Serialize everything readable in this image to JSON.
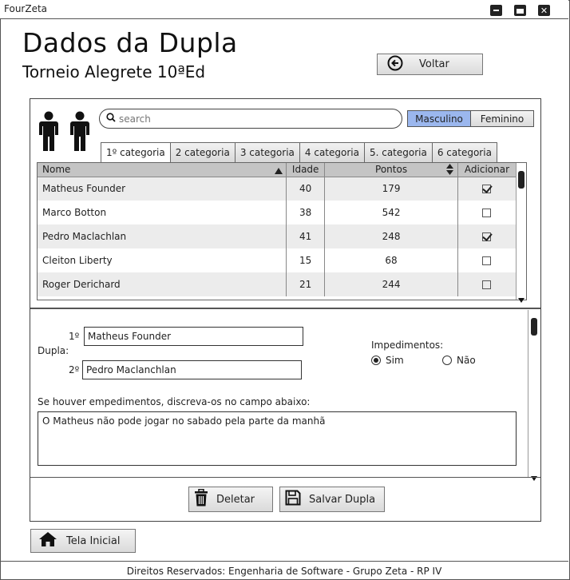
{
  "window": {
    "title": "FourZeta"
  },
  "header": {
    "title": "Dados da Dupla",
    "subtitle": "Torneio Alegrete 10ªEd",
    "back_label": "Voltar"
  },
  "search": {
    "placeholder": "search"
  },
  "gender": {
    "options": [
      "Masculino",
      "Feminino"
    ],
    "selected": "Masculino"
  },
  "tabs": [
    "1º categoria",
    "2 categoria",
    "3 categoria",
    "4 categoria",
    "5. categoria",
    "6 categoria"
  ],
  "active_tab": "1º categoria",
  "table": {
    "columns": [
      "Nome",
      "Idade",
      "Pontos",
      "Adicionar"
    ],
    "rows": [
      {
        "nome": "Matheus Founder",
        "idade": "40",
        "pontos": "179",
        "adicionar": true
      },
      {
        "nome": "Marco Botton",
        "idade": "38",
        "pontos": "542",
        "adicionar": false
      },
      {
        "nome": "Pedro Maclachlan",
        "idade": "41",
        "pontos": "248",
        "adicionar": true
      },
      {
        "nome": "Cleiton Liberty",
        "idade": "15",
        "pontos": "68",
        "adicionar": false
      },
      {
        "nome": "Roger Derichard",
        "idade": "21",
        "pontos": "244",
        "adicionar": false
      }
    ]
  },
  "form": {
    "dupla_label": "Dupla:",
    "player1_label": "1º",
    "player1_value": "Matheus Founder",
    "player2_label": "2º",
    "player2_value": "Pedro Maclanchlan",
    "impedimentos_label": "Impedimentos:",
    "sim_label": "Sim",
    "nao_label": "Não",
    "impedimentos_selected": "Sim",
    "notes_label": "Se houver empedimentos, discreva-os no campo abaixo:",
    "notes_value": "O Matheus não pode jogar no sabado pela parte da manhã"
  },
  "actions": {
    "delete_label": "Deletar",
    "save_label": "Salvar Dupla",
    "home_label": "Tela Inicial"
  },
  "footer": {
    "text": "Direitos Reservados: Engenharia de Software - Grupo Zeta - RP IV"
  },
  "colors": {
    "toggle_active": "#9bb7ee",
    "table_header": "#c4c4c4",
    "row_alt": "#ececec"
  }
}
